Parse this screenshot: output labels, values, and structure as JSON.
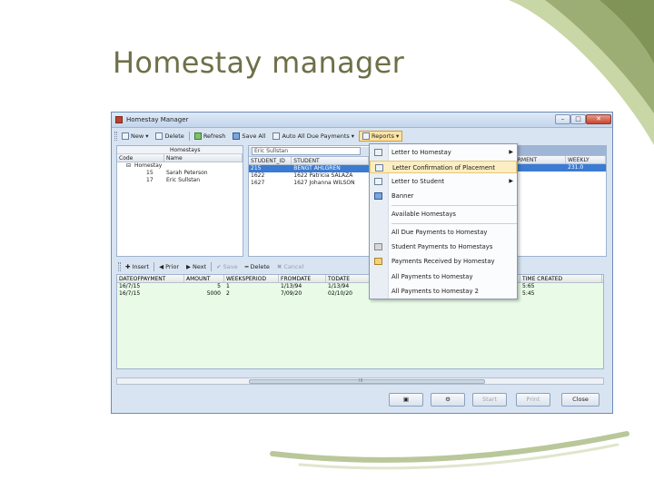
{
  "slide": {
    "title": "Homestay manager"
  },
  "window": {
    "title": "Homestay Manager",
    "controls": {
      "minimize": "–",
      "maximize": "□",
      "close": "✕"
    }
  },
  "toolbar": {
    "new_label": "New",
    "delete_label": "Delete",
    "refresh_label": "Refresh",
    "save_all_label": "Save All",
    "auto_all_due_label": "Auto All Due Payments",
    "reports_label": "Reports"
  },
  "homestays_grid": {
    "group_header": "Homestays",
    "columns": [
      "Code",
      "Name"
    ],
    "tree_root": "Homestay",
    "rows": [
      {
        "code": "15",
        "name": "Sarah Peterson"
      },
      {
        "code": "17",
        "name": "Eric Sullstan"
      }
    ]
  },
  "students_grid": {
    "filter_value": "Eric Sullstan",
    "columns": [
      "STUDENT_ID",
      "STUDENT"
    ],
    "rows": [
      {
        "id": "215",
        "student": "BENGT AHLGREN"
      },
      {
        "id": "1622",
        "student": "1622 Patricia SALAZA"
      },
      {
        "id": "1627",
        "student": "1627 Johanna WILSON"
      }
    ]
  },
  "right_grid": {
    "columns": [
      "ORMENT",
      "WEEKLY"
    ],
    "rows": [
      {
        "c1": "",
        "c2": "231.0"
      }
    ]
  },
  "reports_menu": {
    "items": [
      {
        "label": "Letter to Homestay",
        "submenu": true
      },
      {
        "label": "Letter Confirmation of Placement",
        "submenu": false
      },
      {
        "label": "Letter to Student",
        "submenu": true
      },
      {
        "label": "Banner",
        "submenu": false
      },
      {
        "label": "Available Homestays",
        "submenu": false
      },
      {
        "label": "All Due Payments to Homestay",
        "submenu": false
      },
      {
        "label": "Student Payments to Homestays",
        "submenu": false
      },
      {
        "label": "Payments Received by Homestay",
        "submenu": false
      },
      {
        "label": "All Payments to Homestay",
        "submenu": false
      },
      {
        "label": "All Payments to Homestay 2",
        "submenu": false
      }
    ]
  },
  "payments_toolbar": {
    "insert_label": "Insert",
    "prior_label": "Prior",
    "next_label": "Next",
    "save_label": "Save",
    "delete_label": "Delete",
    "cancel_label": "Cancel"
  },
  "payments_grid": {
    "columns": [
      "DATEOFPAYMENT",
      "AMOUNT",
      "WEEKSPERIOD",
      "FROMDATE",
      "TODATE",
      "TIME CREATED"
    ],
    "rows": [
      {
        "date": "16/7/15",
        "amount": "5",
        "weeks": "1",
        "from": "1/13/94",
        "to": "1/13/94",
        "time": "5:65"
      },
      {
        "date": "16/7/15",
        "amount": "5000",
        "weeks": "2",
        "from": "7/09/20",
        "to": "02/10/20",
        "time": "5:45"
      }
    ]
  },
  "scrollbar": {
    "grip": "III"
  },
  "bottom_buttons": {
    "start_label": "Start",
    "print_label": "Print",
    "close_label": "Close"
  },
  "colors": {
    "title": "#6e7048",
    "window_bg": "#d8e4f2",
    "selection": "#3b7bd1",
    "payments_bg": "#e9fbe7",
    "menu_highlight": "#fbeec2"
  }
}
